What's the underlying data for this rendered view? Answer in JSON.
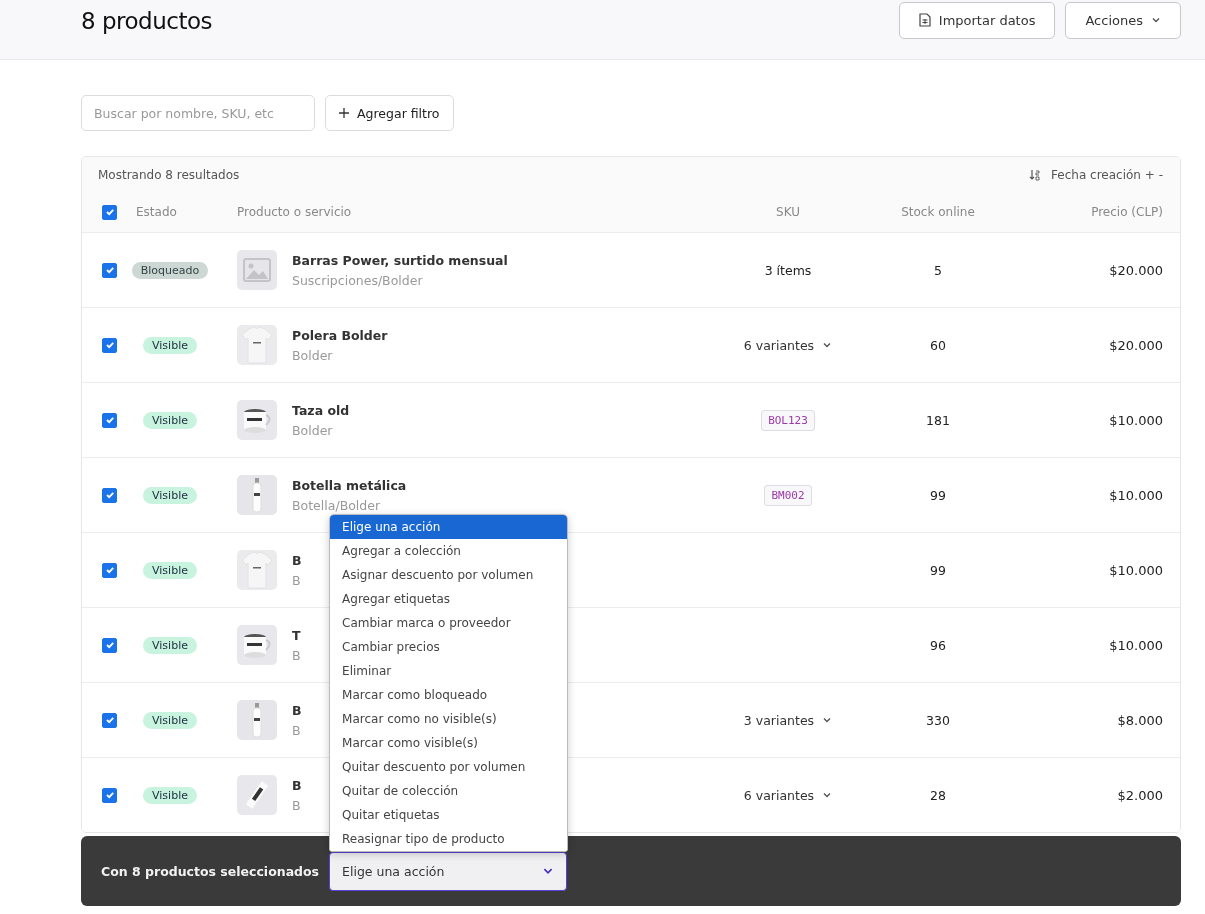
{
  "header": {
    "title": "8 productos",
    "buttons": [
      {
        "label": "Importar datos",
        "kind": "import"
      },
      {
        "label": "Acciones",
        "kind": "menu"
      }
    ]
  },
  "toolbar": {
    "search": {
      "placeholder": "Buscar por nombre, SKU, etc"
    },
    "filter_button": "Agregar filtro"
  },
  "table": {
    "summary": "Mostrando 8 resultados",
    "sort": "Fecha creación + -",
    "select_all": {
      "checked": true
    },
    "columns": [
      "Estado",
      "Producto o servicio",
      "SKU",
      "Stock online",
      "Precio (CLP)"
    ],
    "rows": [
      {
        "checked": true,
        "status": {
          "label": "Bloqueado",
          "kind": "blocked"
        },
        "thumbnail": {
          "kind": "placeholder"
        },
        "name": "Barras Power, surtido mensual",
        "category": "Suscripciones/Bolder",
        "sku": {
          "kind": "text",
          "text": "3 ítems"
        },
        "stock": "5",
        "price": "$20.000"
      },
      {
        "checked": true,
        "status": {
          "label": "Visible",
          "kind": "visible"
        },
        "name": "Polera Bolder",
        "category": "Bolder",
        "sku": {
          "kind": "variants",
          "text": "6 variantes"
        },
        "stock": "60",
        "price": "$20.000"
      },
      {
        "checked": true,
        "status": {
          "label": "Visible",
          "kind": "visible"
        },
        "name": "Taza old",
        "category": "Bolder",
        "sku": {
          "kind": "code",
          "text": "BOL123"
        },
        "stock": "181",
        "price": "$10.000"
      },
      {
        "checked": true,
        "status": {
          "label": "Visible",
          "kind": "visible"
        },
        "name": "Botella metálica",
        "category": "Botella/Bolder",
        "sku": {
          "kind": "code",
          "text": "BM002"
        },
        "stock": "99",
        "price": "$10.000"
      },
      {
        "checked": true,
        "status": {
          "label": "Visible",
          "kind": "visible"
        },
        "name": "B",
        "category": "B",
        "stock": "99",
        "price": "$10.000"
      },
      {
        "checked": true,
        "status": {
          "label": "Visible",
          "kind": "visible"
        },
        "name": "T",
        "category": "B",
        "stock": "96",
        "price": "$10.000"
      },
      {
        "checked": true,
        "status": {
          "label": "Visible",
          "kind": "visible"
        },
        "name": "B",
        "category": "B",
        "sku": {
          "kind": "variants",
          "text": "3 variantes"
        },
        "stock": "330",
        "price": "$8.000"
      },
      {
        "checked": true,
        "status": {
          "label": "Visible",
          "kind": "visible"
        },
        "name": "B",
        "category": "B",
        "sku": {
          "kind": "variants",
          "text": "6 variantes"
        },
        "stock": "28",
        "price": "$2.000"
      }
    ]
  },
  "bulk_bar": {
    "label": "Con 8 productos seleccionados",
    "select": {
      "value": "Elige una acción",
      "expanded": true
    },
    "options": [
      {
        "label": "Elige una acción",
        "selected": true
      },
      {
        "label": "Agregar a colección",
        "selected": false
      },
      {
        "label": "Asignar descuento por volumen",
        "selected": false
      },
      {
        "label": "Agregar etiquetas",
        "selected": false
      },
      {
        "label": "Cambiar marca o proveedor",
        "selected": false
      },
      {
        "label": "Cambiar precios",
        "selected": false
      },
      {
        "label": "Eliminar",
        "selected": false
      },
      {
        "label": "Marcar como bloqueado",
        "selected": false
      },
      {
        "label": "Marcar como no visible(s)",
        "selected": false
      },
      {
        "label": "Marcar como visible(s)",
        "selected": false
      },
      {
        "label": "Quitar descuento por volumen",
        "selected": false
      },
      {
        "label": "Quitar de colección",
        "selected": false
      },
      {
        "label": "Quitar etiquetas",
        "selected": false
      },
      {
        "label": "Reasignar tipo de producto",
        "selected": false
      }
    ]
  }
}
